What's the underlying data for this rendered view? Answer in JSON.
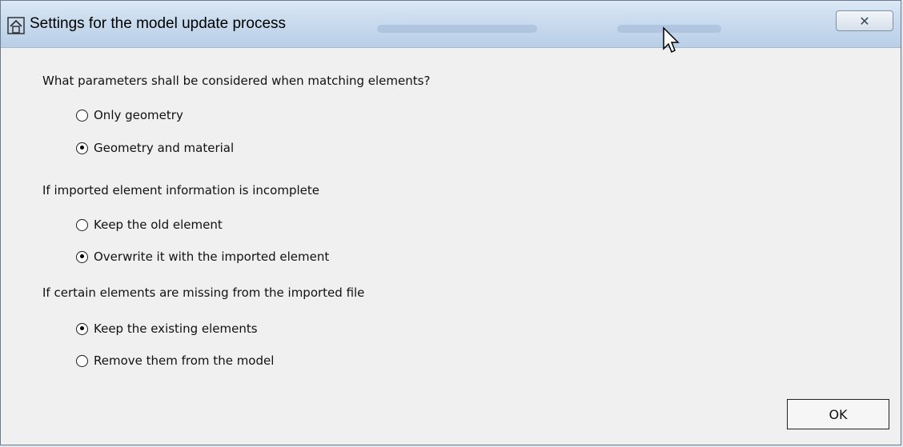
{
  "window": {
    "title": "Settings for the model update process",
    "close_glyph": "✕"
  },
  "sections": [
    {
      "question": "What parameters shall be considered when matching elements?",
      "options": [
        {
          "label": "Only geometry",
          "selected": false
        },
        {
          "label": "Geometry and material",
          "selected": true
        }
      ]
    },
    {
      "question": "If imported element information is incomplete",
      "options": [
        {
          "label": "Keep the old element",
          "selected": false
        },
        {
          "label": "Overwrite it with the imported element",
          "selected": true
        }
      ]
    },
    {
      "question": "If certain elements are missing from the imported file",
      "options": [
        {
          "label": "Keep the existing elements",
          "selected": true
        },
        {
          "label": "Remove them from the model",
          "selected": false
        }
      ]
    }
  ],
  "buttons": {
    "ok_label": "OK"
  },
  "icons": {
    "app": "house-icon",
    "close": "close-icon",
    "cursor": "mouse-cursor-icon"
  },
  "colors": {
    "titlebar": "#c9dbee",
    "dialog_bg": "#f0f0f0"
  }
}
